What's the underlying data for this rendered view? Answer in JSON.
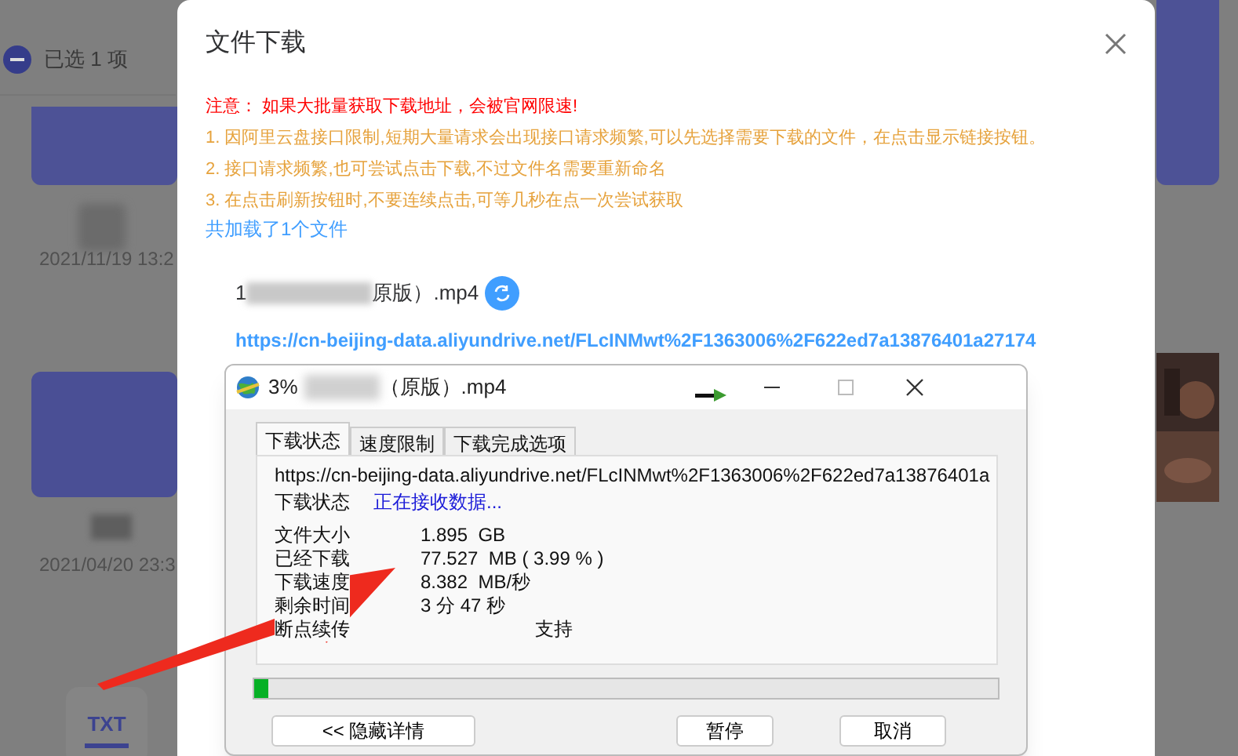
{
  "background": {
    "selection": "已选 1 项",
    "files": [
      {
        "date": "2021/11/19 13:2"
      },
      {
        "date": "2021/04/20 23:3"
      }
    ],
    "file_badge": "TXT"
  },
  "dialog": {
    "title": "文件下载",
    "notice": "注意： 如果大批量获取下载地址，会被官网限速!",
    "tips": [
      "1. 因阿里云盘接口限制,短期大量请求会出现接口请求频繁,可以先选择需要下载的文件，在点击显示链接按钮。",
      "2. 接口请求频繁,也可尝试点击下载,不过文件名需要重新命名",
      "3. 在点击刷新按钮时,不要连续点击,可等几秒在点一次尝试获取"
    ],
    "loaded": "共加载了1个文件",
    "file": {
      "name_start": "1",
      "name_end": "原版）.mp4"
    },
    "link": "https://cn-beijing-data.aliyundrive.net/FLcINMwt%2F1363006%2F622ed7a13876401a27174"
  },
  "idm": {
    "title_start": "3%",
    "title_end": "（原版）.mp4",
    "tabs": [
      {
        "label": "下载状态",
        "selected": true
      },
      {
        "label": "速度限制",
        "selected": false
      },
      {
        "label": "下载完成选项",
        "selected": false
      }
    ],
    "url": "https://cn-beijing-data.aliyundrive.net/FLcINMwt%2F1363006%2F622ed7a13876401a",
    "status_label": "下载状态",
    "status": "正在接收数据...",
    "rows": [
      {
        "kind": "stat",
        "label": "文件大小",
        "value": "1.895  GB"
      },
      {
        "kind": "stat",
        "label": "已经下载",
        "value": "77.527  MB ( 3.99 % )"
      },
      {
        "kind": "stat",
        "label": "下载速度",
        "value": "8.382  MB/秒"
      },
      {
        "kind": "stat",
        "label": "剩余时间",
        "value": "3 分 47 秒"
      },
      {
        "kind": "flag",
        "label": "断点续传",
        "value": "支持"
      }
    ],
    "progress": {
      "level": 0.02
    },
    "buttons": [
      "<< 隐藏详情",
      "暂停",
      "取消"
    ]
  }
}
